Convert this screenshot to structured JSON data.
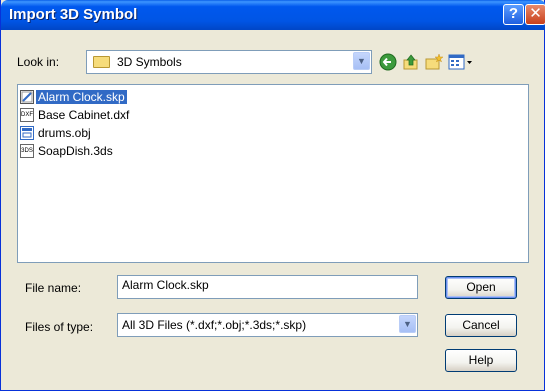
{
  "window": {
    "title": "Import 3D Symbol",
    "help_glyph": "?",
    "close_glyph": "✕"
  },
  "lookin": {
    "label": "Look in:",
    "value": "3D Symbols"
  },
  "toolbar_icons": [
    "back-icon",
    "up-folder-icon",
    "new-folder-icon",
    "views-menu-icon"
  ],
  "files": [
    {
      "name": "Alarm Clock.skp",
      "icon": "skp-file-icon",
      "icon_text": "",
      "selected": true
    },
    {
      "name": "Base Cabinet.dxf",
      "icon": "dxf-file-icon",
      "icon_text": "DXF",
      "selected": false
    },
    {
      "name": "drums.obj",
      "icon": "obj-file-icon",
      "icon_text": "",
      "selected": false
    },
    {
      "name": "SoapDish.3ds",
      "icon": "3ds-file-icon",
      "icon_text": "3DS",
      "selected": false
    }
  ],
  "filename": {
    "label": "File name:",
    "value": "Alarm Clock.skp"
  },
  "filetype": {
    "label": "Files of type:",
    "value": "All 3D Files (*.dxf;*.obj;*.3ds;*.skp)"
  },
  "buttons": {
    "open": "Open",
    "cancel": "Cancel",
    "help": "Help"
  }
}
